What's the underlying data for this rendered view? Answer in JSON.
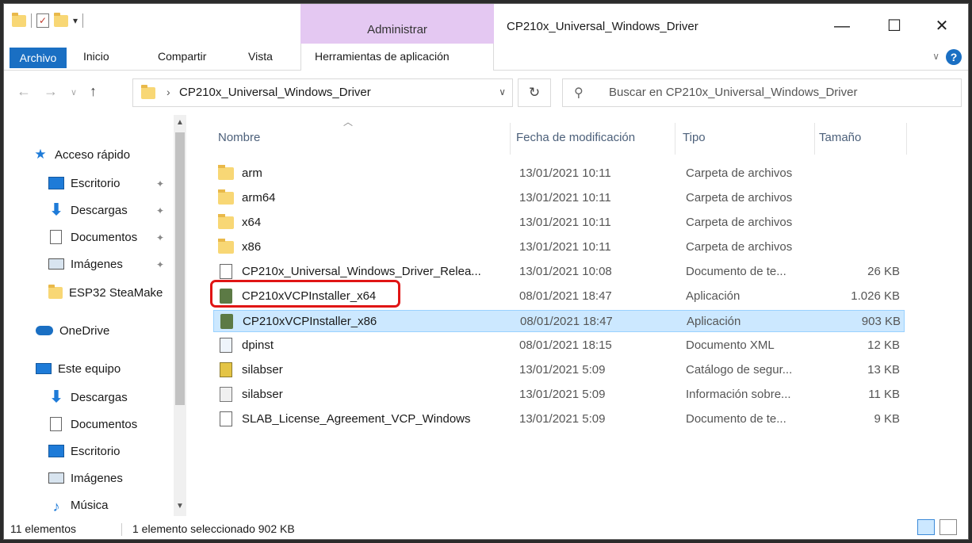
{
  "titlebar": {
    "manage_label": "Administrar",
    "window_title": "CP210x_Universal_Windows_Driver",
    "minimize": "—",
    "maximize": "☐",
    "close": "✕"
  },
  "ribbon": {
    "tabs": [
      "Archivo",
      "Inicio",
      "Compartir",
      "Vista",
      "Herramientas de aplicación"
    ],
    "help": "?"
  },
  "address": {
    "path": "CP210x_Universal_Windows_Driver",
    "search_placeholder": "Buscar en CP210x_Universal_Windows_Driver"
  },
  "sidebar": {
    "items": [
      {
        "label": "Acceso rápido",
        "icon": "star-icon"
      },
      {
        "label": "Escritorio",
        "icon": "desktop-icon",
        "pinned": true
      },
      {
        "label": "Descargas",
        "icon": "download-icon",
        "pinned": true
      },
      {
        "label": "Documentos",
        "icon": "document-icon",
        "pinned": true
      },
      {
        "label": "Imágenes",
        "icon": "pictures-icon",
        "pinned": true
      },
      {
        "label": "ESP32 SteaMake",
        "icon": "folder-icon"
      },
      {
        "label": "OneDrive",
        "icon": "cloud-icon"
      },
      {
        "label": "Este equipo",
        "icon": "pc-icon"
      },
      {
        "label": "Descargas",
        "icon": "download-icon"
      },
      {
        "label": "Documentos",
        "icon": "document-icon"
      },
      {
        "label": "Escritorio",
        "icon": "desktop-icon"
      },
      {
        "label": "Imágenes",
        "icon": "pictures-icon"
      },
      {
        "label": "Música",
        "icon": "music-icon"
      }
    ]
  },
  "columns": [
    "Nombre",
    "Fecha de modificación",
    "Tipo",
    "Tamaño"
  ],
  "files": [
    {
      "name": "arm",
      "date": "13/01/2021 10:11",
      "type": "Carpeta de archivos",
      "size": "",
      "icon": "folder"
    },
    {
      "name": "arm64",
      "date": "13/01/2021 10:11",
      "type": "Carpeta de archivos",
      "size": "",
      "icon": "folder"
    },
    {
      "name": "x64",
      "date": "13/01/2021 10:11",
      "type": "Carpeta de archivos",
      "size": "",
      "icon": "folder"
    },
    {
      "name": "x86",
      "date": "13/01/2021 10:11",
      "type": "Carpeta de archivos",
      "size": "",
      "icon": "folder"
    },
    {
      "name": "CP210x_Universal_Windows_Driver_Relea...",
      "date": "13/01/2021 10:08",
      "type": "Documento de te...",
      "size": "26 KB",
      "icon": "doc"
    },
    {
      "name": "CP210xVCPInstaller_x64",
      "date": "08/01/2021 18:47",
      "type": "Aplicación",
      "size": "1.026 KB",
      "icon": "app"
    },
    {
      "name": "CP210xVCPInstaller_x86",
      "date": "08/01/2021 18:47",
      "type": "Aplicación",
      "size": "903 KB",
      "icon": "app",
      "selected": true
    },
    {
      "name": "dpinst",
      "date": "08/01/2021 18:15",
      "type": "Documento XML",
      "size": "12 KB",
      "icon": "xml"
    },
    {
      "name": "silabser",
      "date": "13/01/2021 5:09",
      "type": "Catálogo de segur...",
      "size": "13 KB",
      "icon": "cat"
    },
    {
      "name": "silabser",
      "date": "13/01/2021 5:09",
      "type": "Información sobre...",
      "size": "11 KB",
      "icon": "info"
    },
    {
      "name": "SLAB_License_Agreement_VCP_Windows",
      "date": "13/01/2021 5:09",
      "type": "Documento de te...",
      "size": "9 KB",
      "icon": "doc"
    }
  ],
  "status": {
    "count": "11 elementos",
    "selection": "1 elemento seleccionado  902 KB"
  },
  "colors": {
    "accent": "#1a6fc3",
    "manage_tab": "#e4c8f2",
    "selected_row": "#cce8ff",
    "highlight": "#e01515"
  }
}
